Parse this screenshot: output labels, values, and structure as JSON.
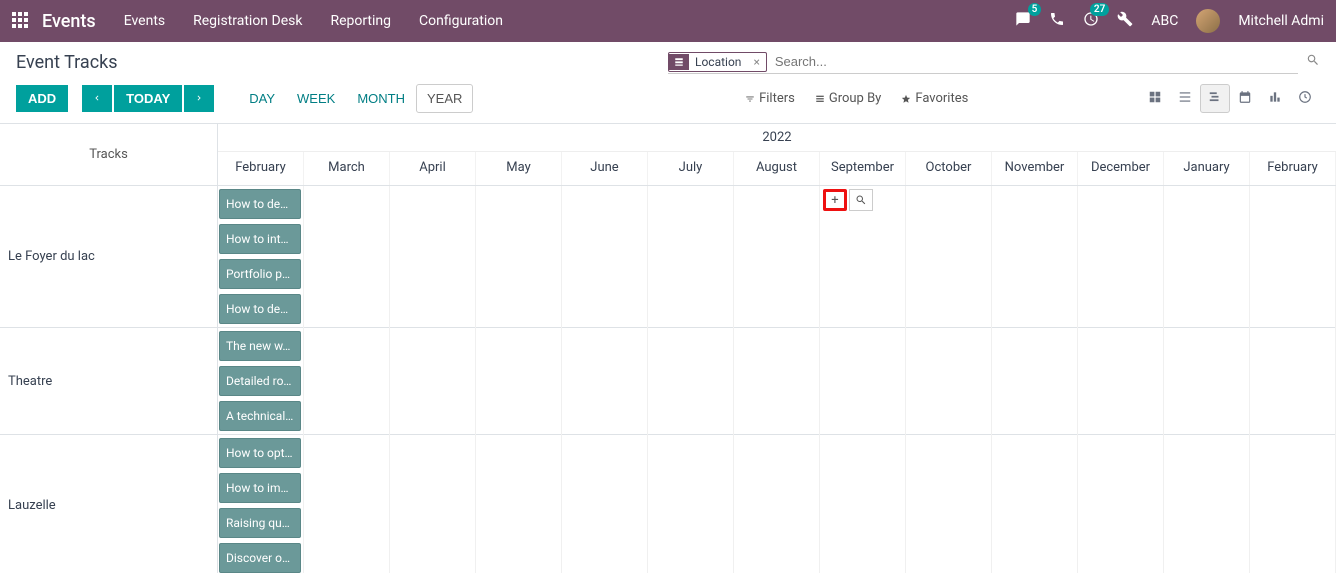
{
  "topnav": {
    "brand": "Events",
    "menu": [
      "Events",
      "Registration Desk",
      "Reporting",
      "Configuration"
    ],
    "chat_badge": "5",
    "activity_badge": "27",
    "company": "ABC",
    "username": "Mitchell Admi"
  },
  "control": {
    "page_title": "Event Tracks",
    "facet_label": "Location",
    "search_placeholder": "Search...",
    "add_label": "ADD",
    "today_label": "TODAY",
    "scales": [
      "DAY",
      "WEEK",
      "MONTH",
      "YEAR"
    ],
    "active_scale": "YEAR",
    "filters_label": "Filters",
    "groupby_label": "Group By",
    "favorites_label": "Favorites"
  },
  "gantt": {
    "side_header": "Tracks",
    "year": "2022",
    "months": [
      "February",
      "March",
      "April",
      "May",
      "June",
      "July",
      "August",
      "September",
      "October",
      "November",
      "December",
      "January",
      "February"
    ],
    "rows": [
      {
        "label": "Le Foyer du lac",
        "pills": [
          "How to de…",
          "How to int…",
          "Portfolio p…",
          "How to de…"
        ]
      },
      {
        "label": "Theatre",
        "pills": [
          "The new w…",
          "Detailed ro…",
          "A technical…"
        ]
      },
      {
        "label": "Lauzelle",
        "pills": [
          "How to opt…",
          "How to im…",
          "Raising qu…",
          "Discover o…"
        ]
      }
    ]
  }
}
